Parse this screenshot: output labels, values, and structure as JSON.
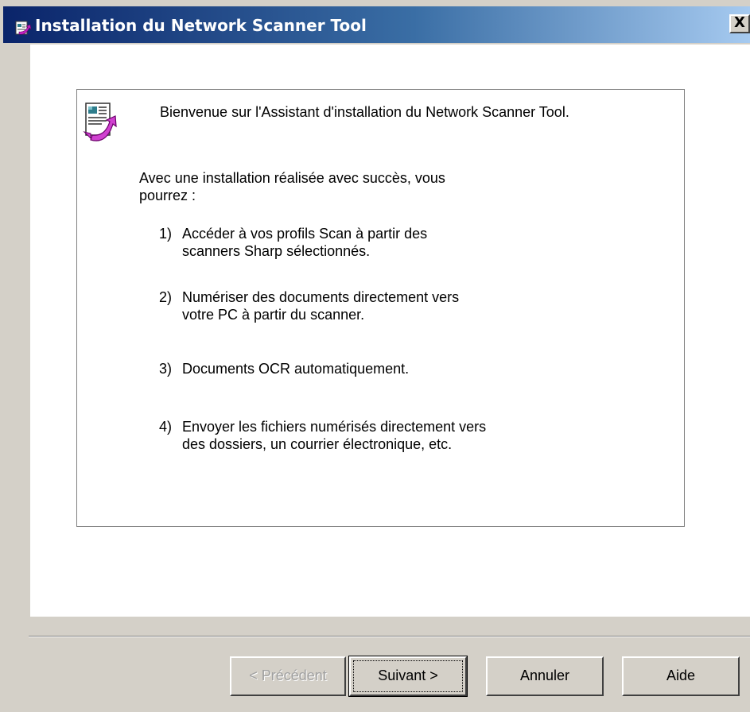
{
  "window": {
    "title": "Installation du Network Scanner Tool",
    "close_label": "X"
  },
  "content": {
    "welcome": "Bienvenue sur l'Assistant d'installation du Network Scanner Tool.",
    "intro_line1": "Avec une installation réalisée avec succès, vous",
    "intro_line2": "pourrez :",
    "items": [
      {
        "num": "1)",
        "line1": "Accéder à vos profils Scan à partir des",
        "line2": "scanners Sharp sélectionnés."
      },
      {
        "num": "2)",
        "line1": "Numériser des documents directement vers",
        "line2": "votre PC à partir du scanner."
      },
      {
        "num": "3)",
        "line1": "Documents OCR automatiquement.",
        "line2": ""
      },
      {
        "num": "4)",
        "line1": "Envoyer les fichiers numérisés directement vers",
        "line2": "des dossiers, un courrier électronique, etc."
      }
    ]
  },
  "buttons": {
    "back": "< Précédent",
    "next": "Suivant >",
    "cancel": "Annuler",
    "help": "Aide"
  },
  "icons": {
    "title_icon": "installer-icon",
    "wizard_icon": "wizard-document-arrow-icon"
  }
}
